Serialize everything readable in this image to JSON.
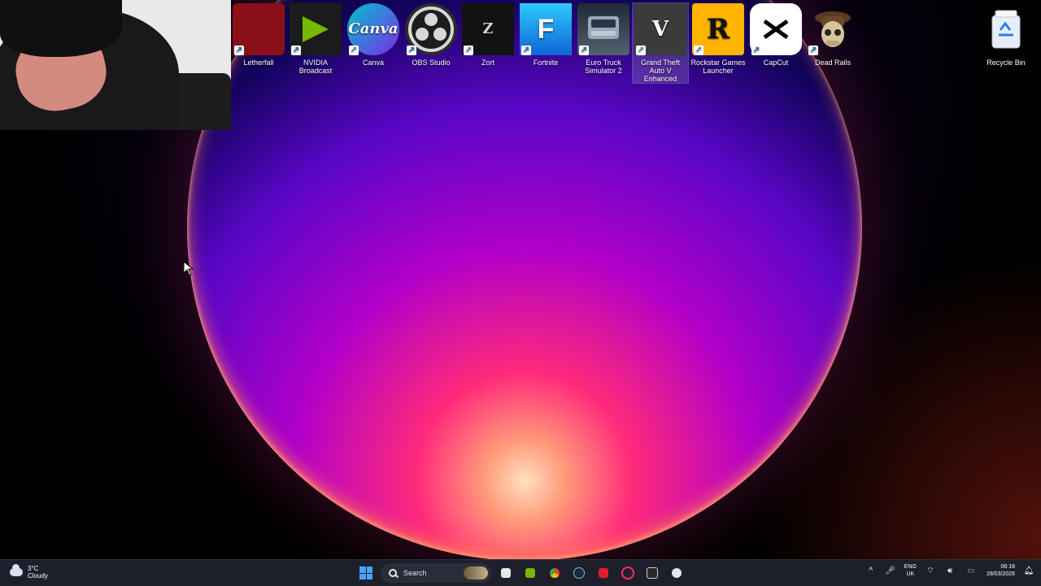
{
  "desktop": {
    "icons": [
      {
        "label": "Letherfall",
        "icon": "letherfall-icon",
        "bg": "#8a0f18"
      },
      {
        "label": "NVIDIA Broadcast",
        "icon": "nvidia-broadcast-icon",
        "bg": "#1b1b1b"
      },
      {
        "label": "Canva",
        "icon": "canva-icon",
        "bg": "#21b3e6"
      },
      {
        "label": "OBS Studio",
        "icon": "obs-studio-icon",
        "bg": "#2b2b2b"
      },
      {
        "label": "Zort",
        "icon": "zort-icon",
        "bg": "#121212"
      },
      {
        "label": "Fortnite",
        "icon": "fortnite-icon",
        "bg": "#1aa0f0"
      },
      {
        "label": "Euro Truck Simulator 2",
        "icon": "euro-truck-simulator-icon",
        "bg": "#2f3d4f"
      },
      {
        "label": "Grand Theft Auto V Enhanced",
        "icon": "gta-v-icon",
        "bg": "#3b3b3b"
      },
      {
        "label": "Rockstar Games Launcher",
        "icon": "rockstar-games-launcher-icon",
        "bg": "#ffb400"
      },
      {
        "label": "CapCut",
        "icon": "capcut-icon",
        "bg": "#ffffff"
      },
      {
        "label": "Dead Rails",
        "icon": "dead-rails-icon",
        "bg": "#2d2419"
      }
    ],
    "recycle_bin": {
      "label": "Recycle Bin",
      "icon": "recycle-bin-icon"
    }
  },
  "taskbar": {
    "weather": {
      "temp": "3°C",
      "condition": "Cloudy",
      "icon": "cloud-icon"
    },
    "search": {
      "placeholder": "Search"
    },
    "apps": [
      {
        "name": "file-manager-icon"
      },
      {
        "name": "nvidia-app-icon"
      },
      {
        "name": "chrome-icon"
      },
      {
        "name": "steam-icon"
      },
      {
        "name": "game-app-icon"
      },
      {
        "name": "opera-gx-icon"
      },
      {
        "name": "epic-games-icon"
      },
      {
        "name": "rockstar-launcher-icon"
      }
    ],
    "tray": {
      "language_top": "ENG",
      "language_bottom": "UK",
      "time": "06:18",
      "date": "28/03/2026"
    }
  }
}
